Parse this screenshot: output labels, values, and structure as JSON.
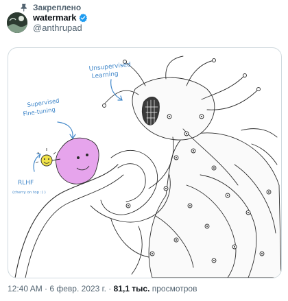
{
  "pinned": {
    "label": "Закреплено",
    "icon": "pin-icon"
  },
  "author": {
    "display_name": "watermark",
    "handle": "@anthrupad",
    "verified": true,
    "verified_color": "#1d9bf0"
  },
  "media": {
    "annotations": {
      "unsupervised": [
        "Unsupervised",
        "Learning"
      ],
      "supervised": [
        "Supervised",
        "Fine-tuning"
      ],
      "rlhf": "RLHF",
      "rlhf_sub": "(cherry on top :) )"
    },
    "accent_pink": "#e6a4ec",
    "accent_yellow": "#f1e34a",
    "annotation_color": "#3f86c9"
  },
  "meta": {
    "time": "12:40 AM",
    "sep1": " · ",
    "date": "6 февр. 2023 г.",
    "sep2": " · ",
    "views": "81,1 тыс.",
    "views_label": " просмотров"
  }
}
